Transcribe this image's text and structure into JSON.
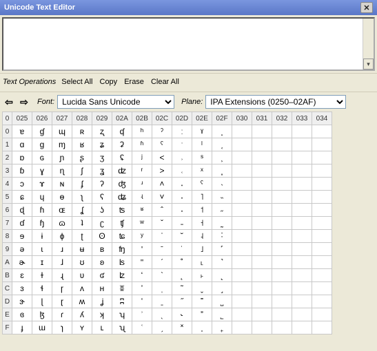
{
  "window": {
    "title": "Unicode Text Editor"
  },
  "ops": {
    "label": "Text Operations",
    "select_all": "Select All",
    "copy": "Copy",
    "erase": "Erase",
    "clear_all": "Clear All"
  },
  "nav": {
    "font_label": "Font:",
    "font_value": "Lucida Sans Unicode",
    "plane_label": "Plane:",
    "plane_value": "IPA Extensions (0250–02AF)"
  },
  "grid": {
    "col_headers": [
      "025",
      "026",
      "027",
      "028",
      "029",
      "02A",
      "02B",
      "02C",
      "02D",
      "02E",
      "02F",
      "030",
      "031",
      "032",
      "033",
      "034"
    ],
    "row_headers": [
      "0",
      "1",
      "2",
      "3",
      "4",
      "5",
      "6",
      "7",
      "8",
      "9",
      "A",
      "B",
      "C",
      "D",
      "E",
      "F"
    ],
    "block_start": 592,
    "highlight": {
      "row": 2,
      "col": 14
    }
  }
}
